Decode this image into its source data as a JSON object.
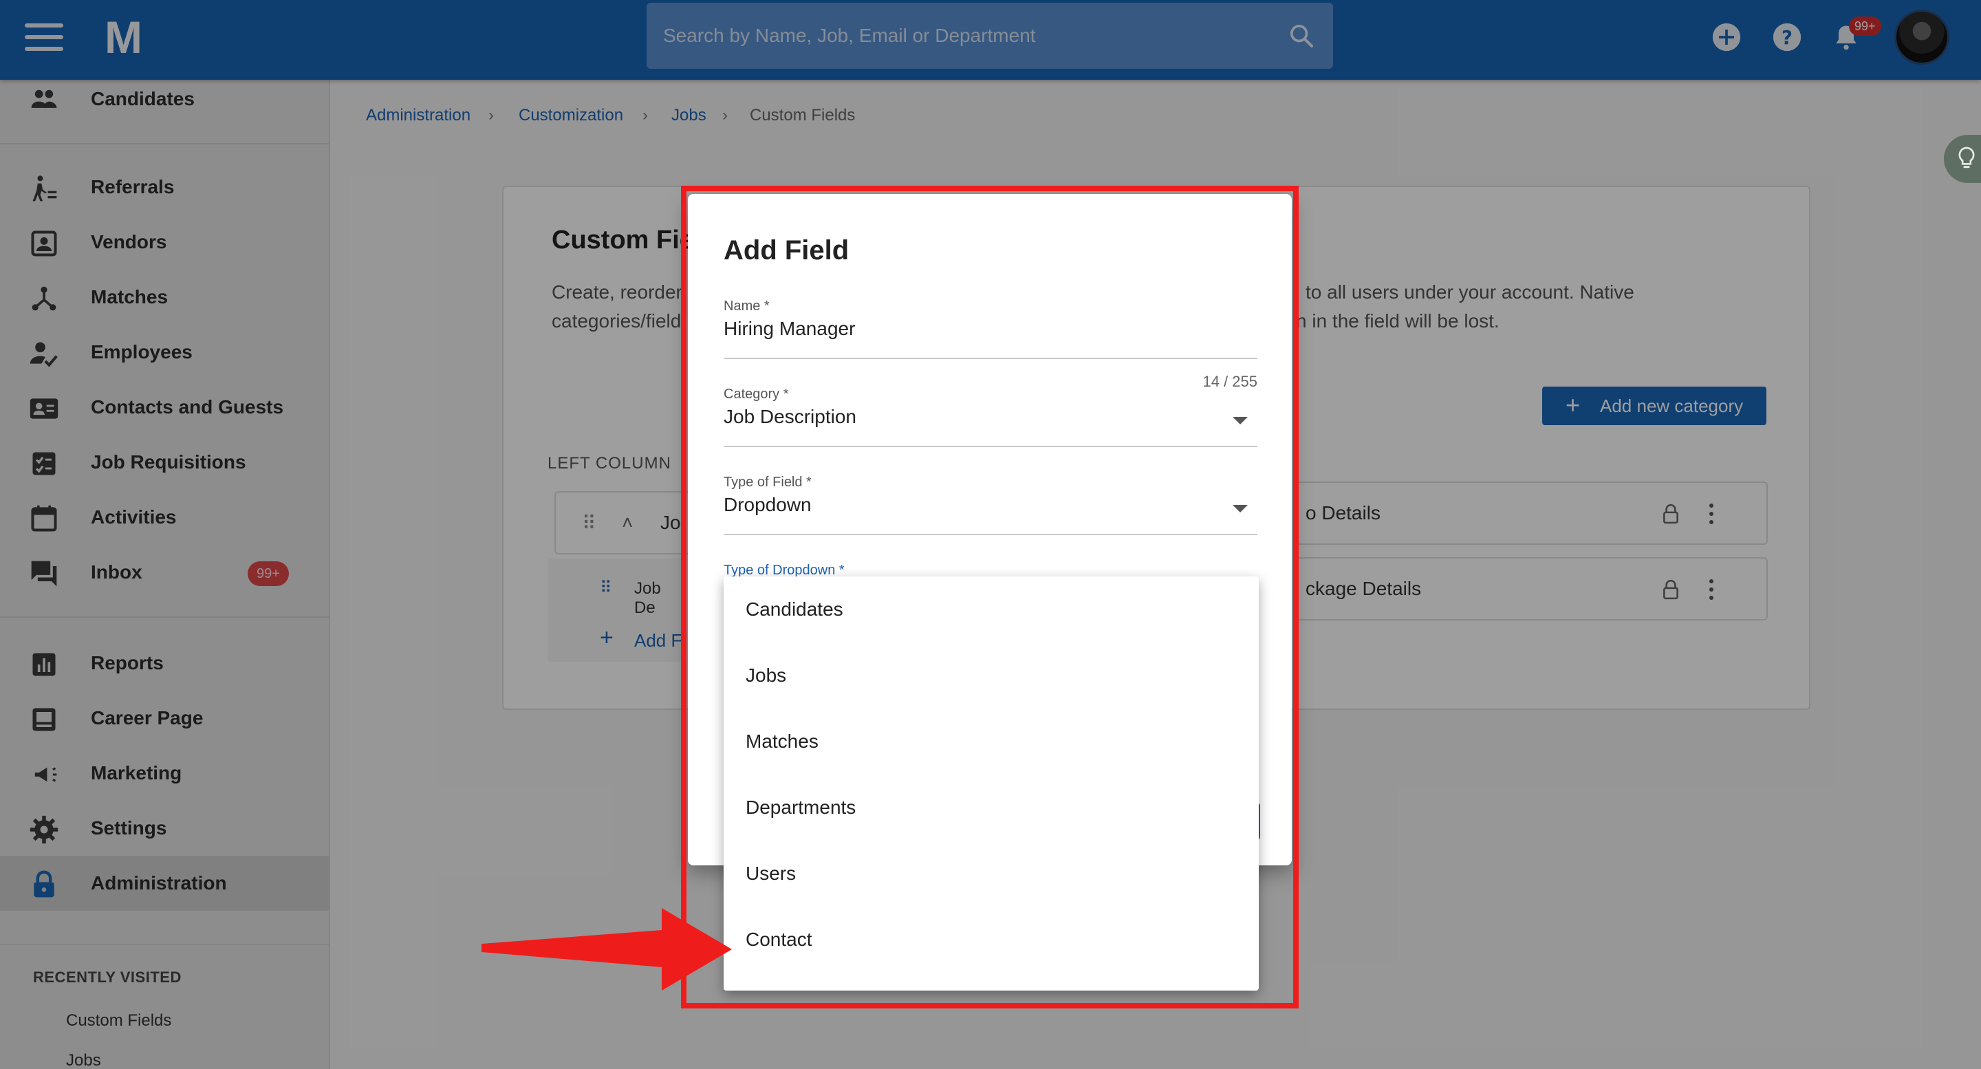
{
  "topbar": {
    "logo": "M",
    "search_placeholder": "Search by Name, Job, Email or Department",
    "notification_badge": "99+"
  },
  "sidebar": {
    "items": [
      {
        "label": "Candidates",
        "icon": "people-icon"
      },
      {
        "label": "Referrals",
        "icon": "referral-icon"
      },
      {
        "label": "Vendors",
        "icon": "vendor-icon"
      },
      {
        "label": "Matches",
        "icon": "matches-icon"
      },
      {
        "label": "Employees",
        "icon": "employee-icon"
      },
      {
        "label": "Contacts and Guests",
        "icon": "contacts-icon"
      },
      {
        "label": "Job Requisitions",
        "icon": "requisition-icon"
      },
      {
        "label": "Activities",
        "icon": "calendar-icon"
      },
      {
        "label": "Inbox",
        "icon": "inbox-icon",
        "badge": "99+"
      },
      {
        "label": "Reports",
        "icon": "reports-icon"
      },
      {
        "label": "Career Page",
        "icon": "career-page-icon"
      },
      {
        "label": "Marketing",
        "icon": "megaphone-icon"
      },
      {
        "label": "Settings",
        "icon": "gear-icon"
      },
      {
        "label": "Administration",
        "icon": "lock-icon",
        "active": true
      }
    ],
    "recent_title": "RECENTLY VISITED",
    "recent": [
      "Custom Fields",
      "Jobs"
    ]
  },
  "breadcrumb": [
    "Administration",
    "Customization",
    "Jobs",
    "Custom Fields"
  ],
  "page": {
    "title": "Custom Fie",
    "desc_line1_left": "Create, reorder,",
    "desc_line1_right": "to all users under your account. Native",
    "desc_line2_left": "categories/field",
    "desc_line2_right": "n in the field will be lost.",
    "add_category_label": "Add new category",
    "left_column_label": "LEFT COLUMN",
    "left_category_partial": "Jo",
    "right_category_1": "o Details",
    "right_category_2": "ckage Details",
    "sub_field_partial": "Job De",
    "add_field_partial": "Add F"
  },
  "dialog": {
    "title": "Add Field",
    "name": {
      "label": "Name *",
      "value": "Hiring Manager",
      "count": "14 / 255"
    },
    "category": {
      "label": "Category *",
      "value": "Job Description"
    },
    "type_of_field": {
      "label": "Type of Field *",
      "value": "Dropdown"
    },
    "type_of_dropdown": {
      "label": "Type of Dropdown *"
    },
    "options": [
      "Candidates",
      "Jobs",
      "Matches",
      "Departments",
      "Users",
      "Contact"
    ]
  },
  "colors": {
    "topbar": "#1764b3",
    "highlight": "#ef1c1c",
    "accent": "#1a66b7"
  }
}
